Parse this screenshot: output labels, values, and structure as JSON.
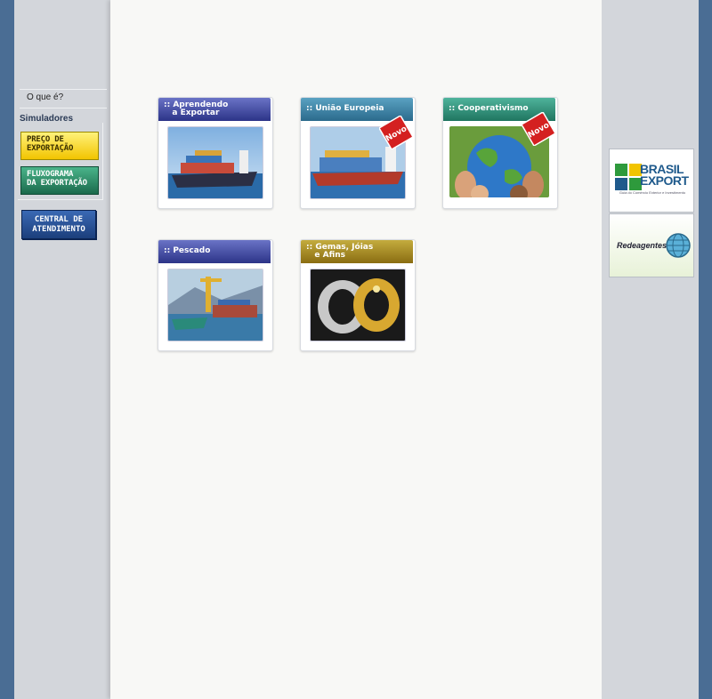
{
  "sidebar": {
    "oque_label": "O que é?",
    "simuladores_title": "Simuladores",
    "preco_label": "PREÇO DE\nEXPORTAÇÃO",
    "fluxo_label": "FLUXOGRAMA\nDA EXPORTAÇÃO",
    "central_label": "CENTRAL DE\nATENDIMENTO"
  },
  "cards": [
    {
      "title": ":: Aprendendo\n   a Exportar",
      "badge": ""
    },
    {
      "title": ":: União Europeia",
      "badge": "Novo"
    },
    {
      "title": ":: Cooperativismo",
      "badge": "Novo"
    },
    {
      "title": ":: Pescado",
      "badge": ""
    },
    {
      "title": ":: Gemas, Jóias\n   e Afins",
      "badge": ""
    }
  ],
  "partners": {
    "brasil_export": "BRASIL\nEXPORT",
    "brasil_export_sub": "Guia do Comércio Exterior e Investimento",
    "redeagentes": "Redeagentes"
  },
  "colors": {
    "outer_bg": "#4a6d94",
    "sidebar_bg": "#d3d6db",
    "content_bg": "#f8f8f6",
    "head_blue": "#2c3488",
    "head_teal": "#2b6a8c",
    "head_green": "#1f7560",
    "head_gold": "#8a6d12",
    "novo_red": "#d42020"
  },
  "icons": {
    "container_ship": "ship-photo",
    "globe_hands": "globe-photo",
    "port_crane": "port-photo",
    "rings": "rings-photo",
    "globe_logo": "globe-icon"
  }
}
